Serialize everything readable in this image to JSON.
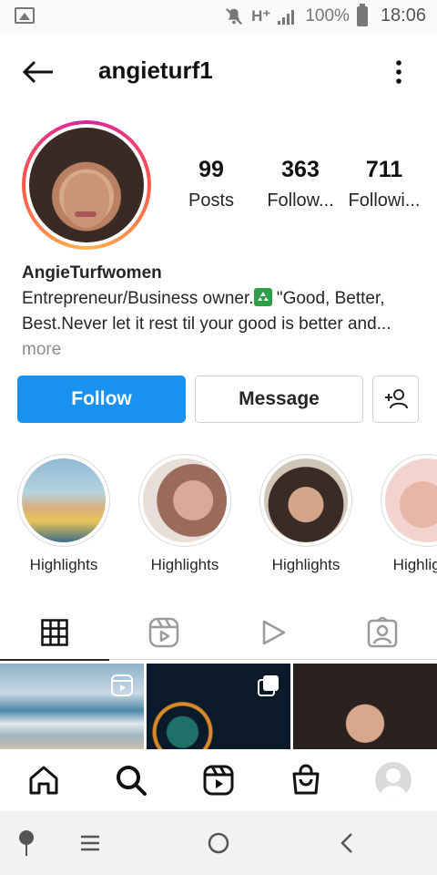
{
  "status_bar": {
    "network": "H⁺",
    "battery": "100%",
    "time": "18:06",
    "icons": [
      "image-icon",
      "mute-icon",
      "signal-icon",
      "battery-icon"
    ]
  },
  "header": {
    "username": "angieturf1",
    "icons": [
      "back-arrow-icon",
      "more-menu-icon"
    ]
  },
  "stats": {
    "posts": {
      "value": "99",
      "label": "Posts"
    },
    "followers": {
      "value": "363",
      "label": "Follow..."
    },
    "following": {
      "value": "711",
      "label": "Followi..."
    }
  },
  "bio": {
    "name": "AngieTurfwomen",
    "text_1": "Entrepreneur/Business owner.",
    "text_2": " \"Good, Better, Best.Never let it rest til your good is better and...",
    "more": " more"
  },
  "actions": {
    "follow": "Follow",
    "message": "Message",
    "add_user_icon": "add-user-icon"
  },
  "highlights": [
    {
      "label": "Highlights"
    },
    {
      "label": "Highlights"
    },
    {
      "label": "Highlights"
    },
    {
      "label": "Highlights"
    }
  ],
  "tabs": [
    "grid-icon",
    "reels-icon",
    "video-icon",
    "tagged-icon"
  ],
  "bottom_nav": [
    "home-icon",
    "search-icon",
    "reels-icon",
    "shop-icon",
    "profile-avatar"
  ],
  "system_nav": [
    "assistant-icon",
    "recents-icon",
    "home-circle-icon",
    "back-icon"
  ],
  "colors": {
    "accent": "#1a91ee",
    "text": "#262626",
    "muted": "#8e8e8e",
    "border": "#dbdbdb"
  }
}
